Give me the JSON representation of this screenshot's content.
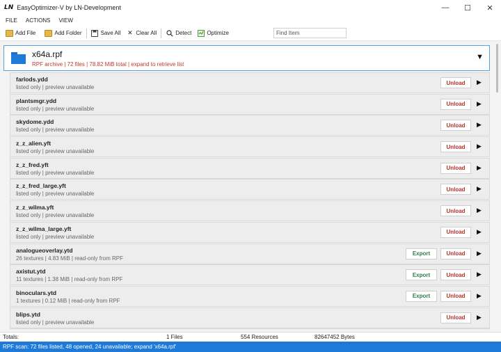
{
  "window": {
    "logo": "LN",
    "title": "EasyOptimizer-V by LN-Development",
    "minimize": "—",
    "maximize": "☐",
    "close": "✕"
  },
  "menu": [
    "FILE",
    "ACTIONS",
    "VIEW"
  ],
  "toolbar": {
    "add_file": "Add File",
    "add_folder": "Add Folder",
    "save_all": "Save All",
    "clear_all": "Clear All",
    "detect": "Detect",
    "optimize": "Optimize",
    "search_placeholder": "Find Item"
  },
  "archive": {
    "name": "x64a.rpf",
    "info": "RPF archive | 72 files | 78.82 MiB total | expand to retrieve list",
    "toggle": "▼"
  },
  "labels": {
    "unload": "Unload",
    "export": "Export",
    "play": "▶"
  },
  "items": [
    {
      "name": "farlods.ydd",
      "meta": "listed only | preview unavailable",
      "export": false
    },
    {
      "name": "plantsmgr.ydd",
      "meta": "listed only | preview unavailable",
      "export": false
    },
    {
      "name": "skydome.ydd",
      "meta": "listed only | preview unavailable",
      "export": false
    },
    {
      "name": "z_z_alien.yft",
      "meta": "listed only | preview unavailable",
      "export": false
    },
    {
      "name": "z_z_fred.yft",
      "meta": "listed only | preview unavailable",
      "export": false
    },
    {
      "name": "z_z_fred_large.yft",
      "meta": "listed only | preview unavailable",
      "export": false
    },
    {
      "name": "z_z_wilma.yft",
      "meta": "listed only | preview unavailable",
      "export": false
    },
    {
      "name": "z_z_wilma_large.yft",
      "meta": "listed only | preview unavailable",
      "export": false
    },
    {
      "name": "analogueoverlay.ytd",
      "meta": "26 textures | 4.83 MiB | read-only from RPF",
      "export": true
    },
    {
      "name": "axistut.ytd",
      "meta": "11 textures | 1.38 MiB | read-only from RPF",
      "export": true
    },
    {
      "name": "binoculars.ytd",
      "meta": "1 textures | 0.12 MiB | read-only from RPF",
      "export": true
    },
    {
      "name": "blips.ytd",
      "meta": "listed only | preview unavailable",
      "export": false
    },
    {
      "name": "",
      "meta": "",
      "export": false
    }
  ],
  "totals": {
    "label": "Totals:",
    "files": "1 Files",
    "resources": "554 Resources",
    "bytes": "82647452 Bytes"
  },
  "status": "RPF scan: 72 files listed, 48 opened, 24 unavailable; expand 'x64a.rpf'",
  "colors": {
    "accent": "#1e7ad9",
    "unload": "#b0332a",
    "export": "#2e7d4f",
    "archive_info": "#c0392b"
  }
}
